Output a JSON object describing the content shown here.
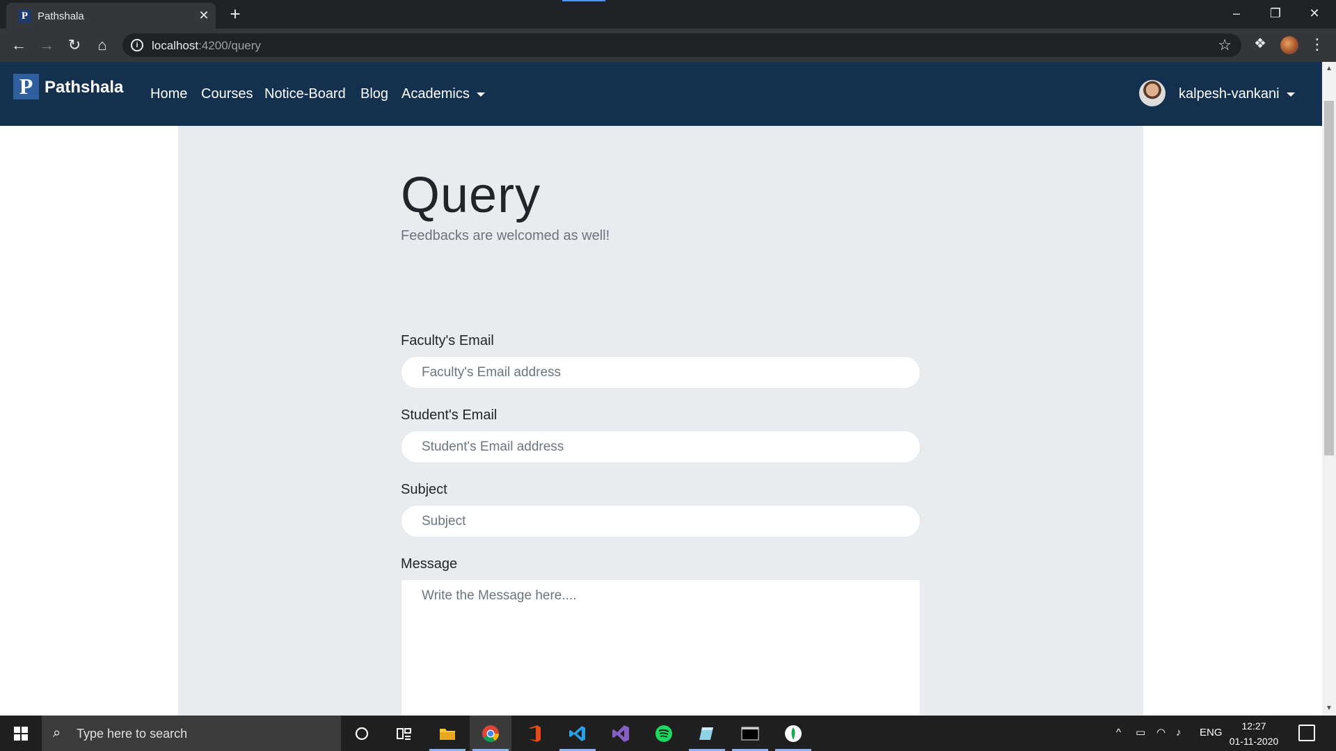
{
  "browser": {
    "tab_title": "Pathshala",
    "tab_favicon_letter": "P",
    "url_host": "localhost",
    "url_path": ":4200/query"
  },
  "navbar": {
    "brand_logo_letter": "P",
    "brand_name": "Pathshala",
    "links": [
      "Home",
      "Courses",
      "Notice-Board",
      "Blog",
      "Academics"
    ],
    "user_name": "kalpesh-vankani"
  },
  "page": {
    "title": "Query",
    "subtitle": "Feedbacks are welcomed as well!",
    "fields": {
      "faculty_label": "Faculty's Email",
      "faculty_placeholder": "Faculty's Email address",
      "student_label": "Student's Email",
      "student_placeholder": "Student's Email address",
      "subject_label": "Subject",
      "subject_placeholder": "Subject",
      "message_label": "Message",
      "message_placeholder": "Write the Message here...."
    }
  },
  "taskbar": {
    "search_placeholder": "Type here to search",
    "language": "ENG",
    "time": "12:27",
    "date": "01-11-2020",
    "pinned_apps": [
      "cortana",
      "task-view",
      "file-explorer",
      "chrome",
      "office",
      "vscode",
      "visual-studio",
      "spotify",
      "sticky-notes",
      "terminal",
      "mongodb"
    ]
  },
  "colors": {
    "navbar_bg": "#14304f",
    "content_bg": "#e9ecef",
    "brand_logo_bg": "#2f5f9c",
    "chrome_dark": "#202124",
    "chrome_toolbar": "#35363a"
  }
}
